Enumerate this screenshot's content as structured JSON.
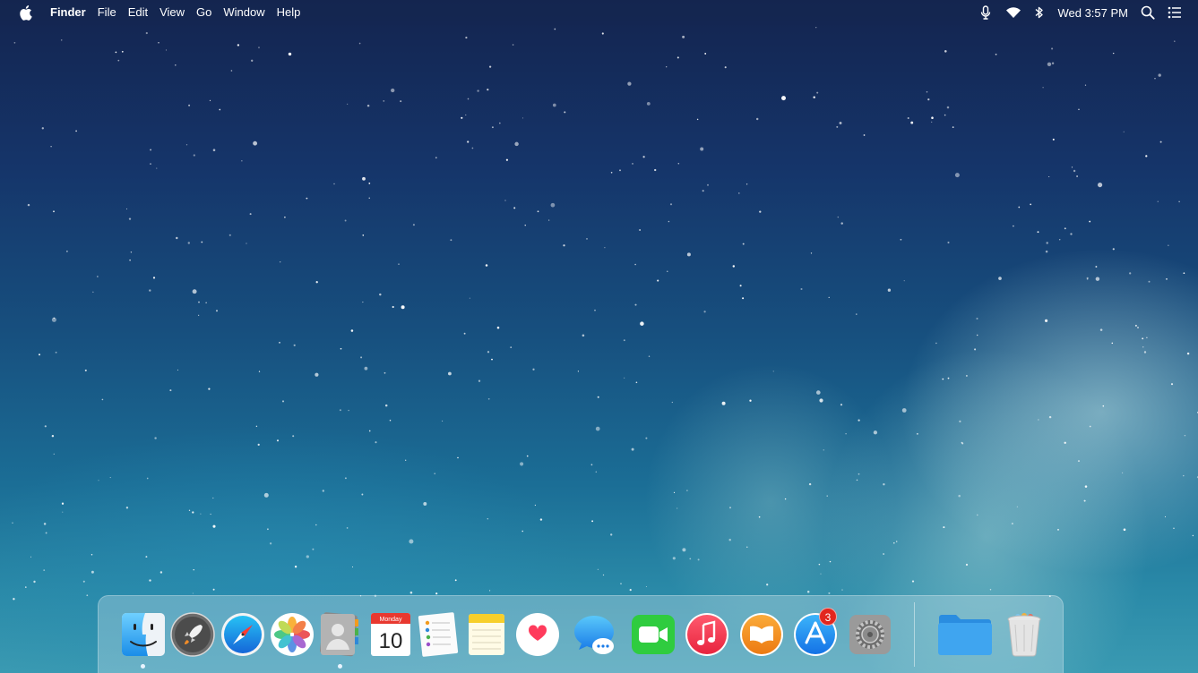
{
  "menubar": {
    "apple_icon": "apple-logo-icon",
    "app_name": "Finder",
    "menus": [
      "File",
      "Edit",
      "View",
      "Go",
      "Window",
      "Help"
    ],
    "status_icons": [
      "microphone-icon",
      "wifi-icon",
      "bluetooth-icon"
    ],
    "clock": "Wed 3:57 PM",
    "right_icons": [
      "spotlight-search-icon",
      "notification-center-icon"
    ]
  },
  "dock": {
    "apps": [
      {
        "name": "Finder",
        "icon": "finder-icon",
        "running": true
      },
      {
        "name": "Launchpad",
        "icon": "launchpad-rocket-icon",
        "running": false
      },
      {
        "name": "Safari",
        "icon": "safari-compass-icon",
        "running": false
      },
      {
        "name": "Photos",
        "icon": "photos-flower-icon",
        "running": false
      },
      {
        "name": "Contacts",
        "icon": "contacts-icon",
        "running": true
      },
      {
        "name": "Calendar",
        "icon": "calendar-icon",
        "running": false
      },
      {
        "name": "Reminders",
        "icon": "reminders-icon",
        "running": false
      },
      {
        "name": "Notes",
        "icon": "notes-icon",
        "running": false
      },
      {
        "name": "Health",
        "icon": "heart-icon",
        "running": false
      },
      {
        "name": "Messages",
        "icon": "messages-bubble-icon",
        "running": false
      },
      {
        "name": "FaceTime",
        "icon": "facetime-camera-icon",
        "running": false
      },
      {
        "name": "Music",
        "icon": "music-note-icon",
        "running": false
      },
      {
        "name": "Books",
        "icon": "books-icon",
        "running": false
      },
      {
        "name": "App Store",
        "icon": "app-store-icon",
        "running": false
      },
      {
        "name": "System Preferences",
        "icon": "gear-icon",
        "running": false
      }
    ],
    "calendar": {
      "month": "Monday",
      "day": "10"
    },
    "app_store_badge": "3",
    "others": [
      {
        "name": "Documents",
        "icon": "folder-icon"
      },
      {
        "name": "Trash",
        "icon": "trash-icon"
      }
    ]
  },
  "colors": {
    "badge": "#e2261e",
    "folder": "#3fa5f0",
    "facetime": "#2fcc3f",
    "music": "#f23a4f",
    "books": "#f08a1c",
    "app_store": "#1f8ff2"
  }
}
